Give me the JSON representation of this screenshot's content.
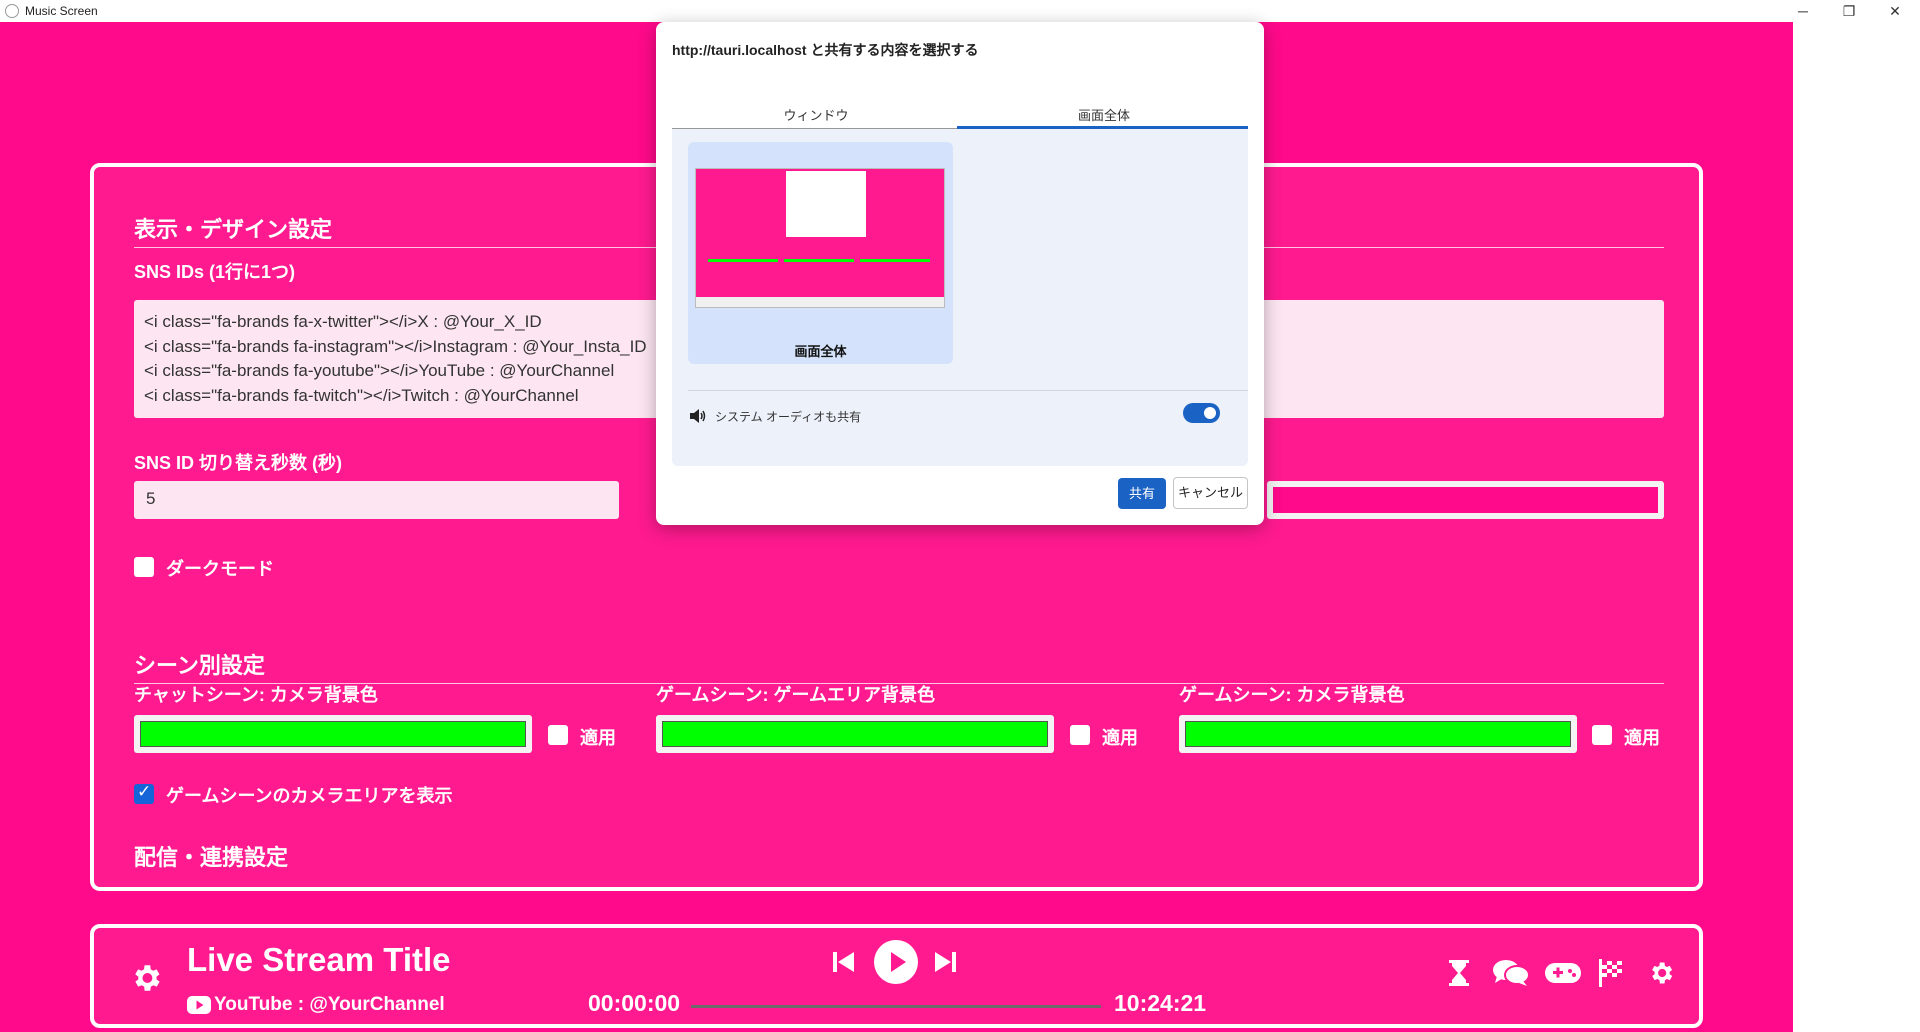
{
  "window": {
    "title": "Music Screen",
    "minimize": "─",
    "maximize": "❐",
    "close": "✕"
  },
  "settings": {
    "display_title": "表示・デザイン設定",
    "sns_ids_label": "SNS IDs (1行に1つ)",
    "sns_ids_value": "<i class=\"fa-brands fa-x-twitter\"></i>X : @Your_X_ID\n<i class=\"fa-brands fa-instagram\"></i>Instagram : @Your_Insta_ID\n<i class=\"fa-brands fa-youtube\"></i>YouTube : @YourChannel\n<i class=\"fa-brands fa-twitch\"></i>Twitch : @YourChannel",
    "sns_interval_label": "SNS ID 切り替え秒数 (秒)",
    "sns_interval_value": "5",
    "dark_mode_label": "ダークモード",
    "dark_mode_checked": false,
    "background_color": "#ff0a8a",
    "scene_title": "シーン別設定",
    "scene_colors": [
      {
        "label": "チャットシーン: カメラ背景色",
        "color": "#00ff00",
        "apply_label": "適用",
        "checked": false
      },
      {
        "label": "ゲームシーン: ゲームエリア背景色",
        "color": "#00ff00",
        "apply_label": "適用",
        "checked": false
      },
      {
        "label": "ゲームシーン: カメラ背景色",
        "color": "#00ff00",
        "apply_label": "適用",
        "checked": false
      }
    ],
    "show_camera_label": "ゲームシーンのカメラエリアを表示",
    "show_camera_checked": true,
    "stream_title": "配信・連携設定"
  },
  "player": {
    "title": "Live Stream Title",
    "channel": "YouTube : @YourChannel",
    "current_time": "00:00:00",
    "total_time": "10:24:21",
    "progress": 0,
    "icons": [
      "gear-icon",
      "previous-icon",
      "play-icon",
      "next-icon",
      "hourglass-icon",
      "chat-icon",
      "gamepad-icon",
      "flag-checkered-icon",
      "gear-icon"
    ]
  },
  "share_dialog": {
    "title": "http://tauri.localhost と共有する内容を選択する",
    "tabs": [
      "ウィンドウ",
      "画面全体"
    ],
    "active_tab": 1,
    "screen_label": "画面全体",
    "audio_label": "システム オーディオも共有",
    "audio_enabled": true,
    "share_label": "共有",
    "cancel_label": "キャンセル"
  },
  "colors": {
    "accent": "#ff0a8a",
    "panel": "#ff1a8f",
    "primary_blue": "#1a62c4",
    "green": "#00ff00"
  }
}
